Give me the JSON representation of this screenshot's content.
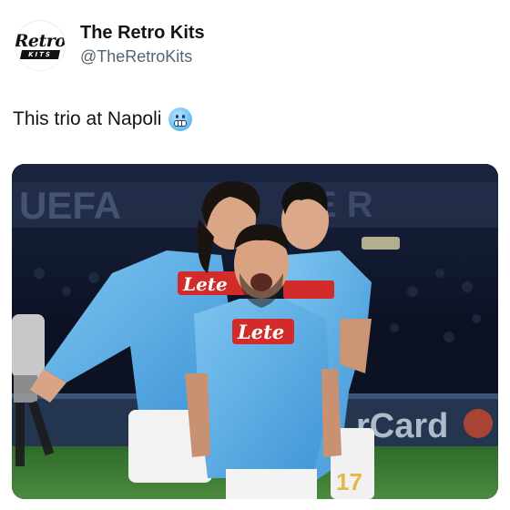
{
  "account": {
    "display_name": "The Retro Kits",
    "handle": "@TheRetroKits",
    "avatar_script": "Retro",
    "avatar_banner": "KITS"
  },
  "post": {
    "text": "This trio at Napoli",
    "emoji": "cold-face-emoji-icon"
  },
  "photo": {
    "subject": "three-napoli-players-celebrating",
    "sponsor_text": "Lete",
    "shirt_number": "17",
    "background_banner_text": "UEFA",
    "board_text": "rCard",
    "colors": {
      "kit": "#5aaee6",
      "sponsor": "#d32a2a",
      "pitch": "#3c7a34",
      "stands": "#0c1428"
    }
  }
}
